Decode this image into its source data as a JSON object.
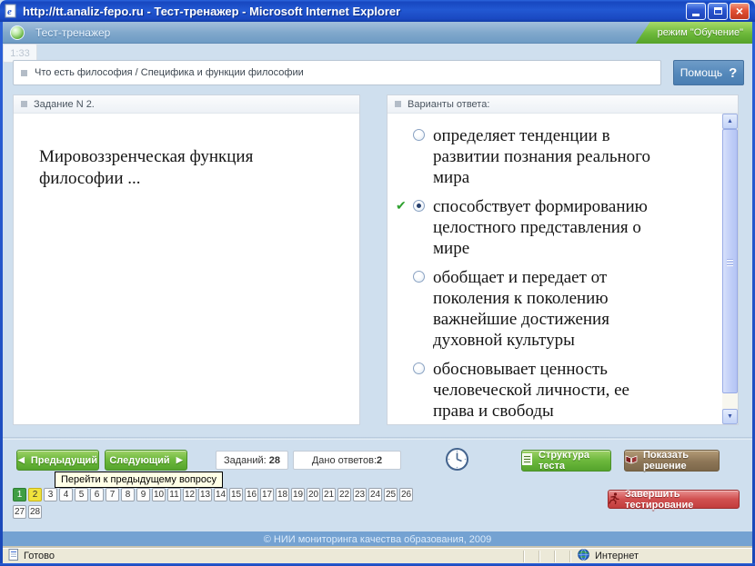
{
  "window": {
    "title": "http://tt.analiz-fepo.ru - Тест-тренажер - Microsoft Internet Explorer",
    "status_left": "Готово",
    "status_right": "Интернет"
  },
  "header": {
    "app_title": "Тест-тренажер",
    "mode_label": "режим \"Обучение\""
  },
  "breadcrumb": {
    "path": "Что есть философия / Специфика и функции философии",
    "help_label": "Помощь"
  },
  "task": {
    "panel_title": "Задание N 2.",
    "question": "Мировоззренческая функция философии ..."
  },
  "answers": {
    "panel_title": "Варианты ответа:",
    "options": [
      {
        "text": "определяет тенденции в развитии познания реального мира",
        "selected": false,
        "correct": false
      },
      {
        "text": "способствует формированию целостного представления о мире",
        "selected": true,
        "correct": true
      },
      {
        "text": "обобщает и передает от поколения к поколению важнейшие достижения духовной культуры",
        "selected": false,
        "correct": false
      },
      {
        "text": "обосновывает ценность человеческой личности, ее права и свободы",
        "selected": false,
        "correct": false
      }
    ]
  },
  "toolbar": {
    "prev_label": "Предыдущий",
    "next_label": "Следующий",
    "tasks_label": "Заданий: ",
    "tasks_count": "28",
    "answered_label": "Дано ответов:",
    "answered_count": "2",
    "timer": "1:33",
    "structure_label": "Структура теста",
    "solution_label": "Показать решение",
    "finish_label": "Завершить тестирование"
  },
  "tooltip": {
    "text": "Перейти к предыдущему вопросу"
  },
  "question_nav": {
    "row1": [
      "1",
      "2",
      "3",
      "4",
      "5",
      "6",
      "7",
      "8",
      "9",
      "10",
      "11",
      "12",
      "13",
      "14",
      "15",
      "16",
      "17",
      "18",
      "19",
      "20",
      "21",
      "22",
      "23",
      "24",
      "25",
      "26"
    ],
    "row2": [
      "27",
      "28"
    ],
    "answered_green": "1",
    "current_yellow": "2"
  },
  "footer": {
    "copyright": "© НИИ мониторинга качества образования, 2009"
  },
  "icons": {
    "correct_check": "✔",
    "arrow_left": "◀",
    "arrow_right": "▶",
    "help_qmark": "?",
    "close_glyph": "×",
    "scroll_up": "▲",
    "scroll_down": "▼"
  },
  "colors": {
    "titlebar_blue": "#2258d2",
    "header_bar": "#7fa7cb",
    "mode_green": "#6cb83a",
    "button_green": "#6cb83c",
    "button_brown": "#8d7657",
    "button_red": "#d15050",
    "cell_answered_green": "#3f9e44",
    "cell_current_yellow": "#f0e23c",
    "footer_blue": "#74a2d2",
    "status_beige": "#ece9d8"
  }
}
